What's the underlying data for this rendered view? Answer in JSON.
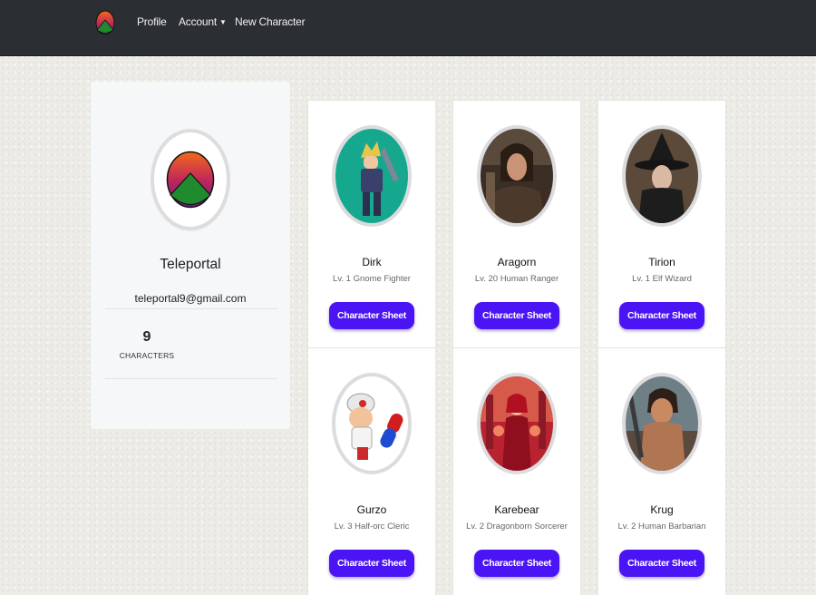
{
  "nav": {
    "logo_icon": "teleportal-logo-icon",
    "profile": "Profile",
    "account": "Account",
    "new_character": "New Character"
  },
  "profile": {
    "username": "Teleportal",
    "email": "teleportal9@gmail.com",
    "characters_count": "9",
    "characters_label": "CHARACTERS"
  },
  "characters": [
    {
      "name": "Dirk",
      "subtitle": "Lv. 1 Gnome Fighter",
      "button": "Character Sheet"
    },
    {
      "name": "Aragorn",
      "subtitle": "Lv. 20 Human Ranger",
      "button": "Character Sheet"
    },
    {
      "name": "Tirion",
      "subtitle": "Lv. 1 Elf Wizard",
      "button": "Character Sheet"
    },
    {
      "name": "Gurzo",
      "subtitle": "Lv. 3 Half-orc Cleric",
      "button": "Character Sheet"
    },
    {
      "name": "Karebear",
      "subtitle": "Lv. 2 Dragonborn Sorcerer",
      "button": "Character Sheet"
    },
    {
      "name": "Krug",
      "subtitle": "Lv. 2 Human Barbarian",
      "button": "Character Sheet"
    }
  ],
  "colors": {
    "navbar": "#2b2f33",
    "button": "#4a14f4",
    "page_background": "#ecebe5",
    "card": "#ffffff"
  }
}
